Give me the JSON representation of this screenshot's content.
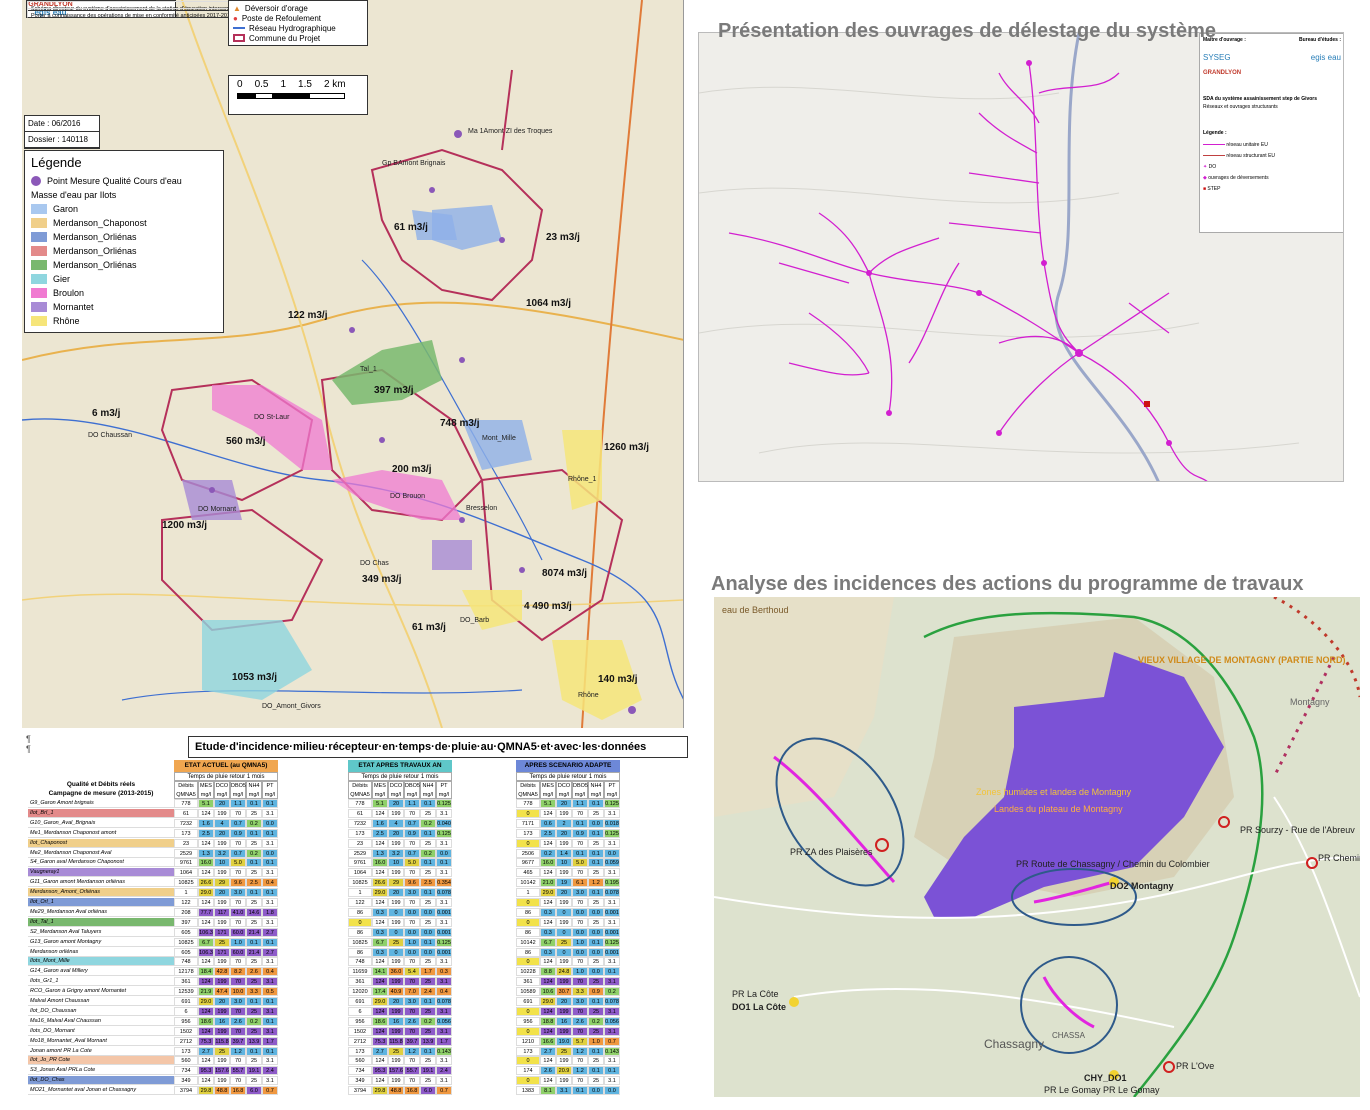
{
  "left_map": {
    "title_box": {
      "schema": "Schéma directeur du système d'assainissement de la station d'épuration intercommunale",
      "logo_grandlyon": "GRANDLYON",
      "porter": "Porter à connaissance des opérations de mise en conformité anticipées 2017-2019",
      "logo_egis": "egis eau"
    },
    "top_legend": [
      "Déversoir d'orage",
      "Poste de Refoulement",
      "Réseau Hydrographique",
      "Commune du Projet"
    ],
    "scale_labels": [
      "0",
      "0.5",
      "1",
      "1.5",
      "2 km"
    ],
    "date": "Date : 06/2016",
    "dossier": "Dossier : 140118",
    "legend": {
      "title": "Légende",
      "point_label": "Point Mesure Qualité Cours d'eau",
      "subtitle": "Masse d'eau par Ilots",
      "items": [
        {
          "label": "Garon",
          "color": "#a9c8ef"
        },
        {
          "label": "Merdanson_Chaponost",
          "color": "#f0cf8a"
        },
        {
          "label": "Merdanson_Orliénas",
          "color": "#7f9bd6"
        },
        {
          "label": "Merdanson_Orliénas",
          "color": "#e38a8a"
        },
        {
          "label": "Merdanson_Orliénas",
          "color": "#79b86e"
        },
        {
          "label": "Gier",
          "color": "#8fd6df"
        },
        {
          "label": "Broulon",
          "color": "#f07ad1"
        },
        {
          "label": "Mornantet",
          "color": "#a88bd6"
        },
        {
          "label": "Rhône",
          "color": "#f6e57a"
        }
      ]
    },
    "flows": [
      "61 m3/j",
      "23 m3/j",
      "1064 m3/j",
      "122 m3/j",
      "397 m3/j",
      "6 m3/j",
      "560 m3/j",
      "748 m3/j",
      "1260 m3/j",
      "200 m3/j",
      "1200 m3/j",
      "349 m3/j",
      "8074 m3/j",
      "4 490 m3/j",
      "61 m3/j",
      "1053 m3/j",
      "140 m3/j"
    ],
    "places": [
      "DO St-Laur",
      "DO Chaussan",
      "DO Mornant",
      "DO Brouon",
      "DO Chas",
      "Mont_Mille",
      "Rhône_1",
      "Tal_1",
      "DO_Barb",
      "DO_Amont_Givors",
      "Rhône",
      "Ma 1Amont ZI des Troques",
      "Bresselon",
      "Gp BAmont Brignais"
    ]
  },
  "table": {
    "title": "Etude·d'incidence·milieu·récepteur·en·temps·de·pluie·au·QMNA5·et·avec·les·données",
    "groups": [
      {
        "label": "ETAT ACTUEL (au QMNA5)",
        "color": "#f0a650"
      },
      {
        "label": "ETAT APRES TRAVAUX AN BOPES",
        "color": "#5fc7c9"
      },
      {
        "label": "APRES SCENARIO ADAPTE BASE EFR",
        "color": "#6d88d8"
      }
    ],
    "subheads": [
      "Temps de pluie retour 1 mois",
      "Temps de pluie retour 1 mois",
      "Temps de pluie retour 1 mois"
    ],
    "left_header": [
      "Qualité et Débits réels",
      "Campagne de mesure (2013-2015)"
    ],
    "cols": [
      "Débits QMNA5 m³/j",
      "MES mg/l",
      "DCO mg/l",
      "DBO5 mg/l",
      "NH4 mg/l",
      "PT mg/l"
    ],
    "rows": [
      {
        "label": "G9_Garon Amont brignais",
        "color": "#ffffff",
        "a": [
          "778",
          "5.1",
          "20",
          "1.1",
          "0.1",
          "0.1"
        ],
        "b": [
          "778",
          "5.1",
          "20",
          "1.1",
          "0.1",
          "0.125"
        ],
        "c": [
          "778",
          "5.1",
          "20",
          "1.1",
          "0.1",
          "0.125"
        ]
      },
      {
        "label": "Ilot_BrI_1",
        "color": "#e38a8a",
        "a": [
          "61",
          "124",
          "199",
          "70",
          "25",
          "3.1"
        ],
        "b": [
          "61",
          "124",
          "199",
          "70",
          "25",
          "3.1"
        ],
        "c": [
          "0",
          "124",
          "199",
          "70",
          "25",
          "3.1"
        ]
      },
      {
        "label": "G10_Garon_Aval_Brignais",
        "color": "#ffffff",
        "a": [
          "7232",
          "1.6",
          "4",
          "0.7",
          "0.2",
          "0.0"
        ],
        "b": [
          "7232",
          "1.6",
          "4",
          "0.7",
          "0.2",
          "0.040"
        ],
        "c": [
          "7171",
          "0.6",
          "2",
          "0.1",
          "0.0",
          "0.018"
        ]
      },
      {
        "label": "Me1_Merdanson Chaponost amont",
        "color": "#ffffff",
        "a": [
          "173",
          "2.5",
          "20",
          "0.9",
          "0.1",
          "0.1"
        ],
        "b": [
          "173",
          "2.5",
          "20",
          "0.9",
          "0.1",
          "0.125"
        ],
        "c": [
          "173",
          "2.5",
          "20",
          "0.9",
          "0.1",
          "0.125"
        ]
      },
      {
        "label": "Ilot_Chaponost",
        "color": "#f0cf8a",
        "a": [
          "23",
          "124",
          "199",
          "70",
          "25",
          "3.1"
        ],
        "b": [
          "23",
          "124",
          "199",
          "70",
          "25",
          "3.1"
        ],
        "c": [
          "0",
          "124",
          "199",
          "70",
          "25",
          "3.1"
        ]
      },
      {
        "label": "Me2_Merdanson Chaponost Aval",
        "color": "#ffffff",
        "a": [
          "2529",
          "1.3",
          "3.2",
          "0.7",
          "0.2",
          "0.0"
        ],
        "b": [
          "2529",
          "1.3",
          "3.2",
          "0.7",
          "0.2",
          "0.0"
        ],
        "c": [
          "2506",
          "0.2",
          "1.4",
          "0.1",
          "0.1",
          "0.0"
        ]
      },
      {
        "label": "S4_Garon aval Merdanson Chaponost",
        "color": "#ffffff",
        "a": [
          "9761",
          "16.0",
          "10",
          "5.0",
          "0.1",
          "0.1"
        ],
        "b": [
          "9761",
          "16.0",
          "10",
          "5.0",
          "0.1",
          "0.1"
        ],
        "c": [
          "9677",
          "16.0",
          "10",
          "5.0",
          "0.1",
          "0.059"
        ]
      },
      {
        "label": "Vaugneray1",
        "color": "#a88bd6",
        "a": [
          "1064",
          "124",
          "199",
          "70",
          "25",
          "3.1"
        ],
        "b": [
          "1064",
          "124",
          "199",
          "70",
          "25",
          "3.1"
        ],
        "c": [
          "465",
          "124",
          "199",
          "70",
          "25",
          "3.1"
        ]
      },
      {
        "label": "G11_Garon amont Merdanson orliénas",
        "color": "#ffffff",
        "a": [
          "10825",
          "26.6",
          "29",
          "9.6",
          "2.5",
          "0.4"
        ],
        "b": [
          "10825",
          "26.6",
          "29",
          "9.6",
          "2.5",
          "0.354"
        ],
        "c": [
          "10142",
          "21.0",
          "19",
          "6.1",
          "1.2",
          "0.195"
        ]
      },
      {
        "label": "Merdanson_Amont_Orliénas",
        "color": "#f0cf8a",
        "a": [
          "1",
          "29.0",
          "20",
          "3.0",
          "0.1",
          "0.1"
        ],
        "b": [
          "1",
          "29.0",
          "20",
          "3.0",
          "0.1",
          "0.078"
        ],
        "c": [
          "1",
          "29.0",
          "20",
          "3.0",
          "0.1",
          "0.078"
        ]
      },
      {
        "label": "Ilot_Orl_1",
        "color": "#7f9bd6",
        "a": [
          "122",
          "124",
          "199",
          "70",
          "25",
          "3.1"
        ],
        "b": [
          "122",
          "124",
          "199",
          "70",
          "25",
          "3.1"
        ],
        "c": [
          "0",
          "124",
          "199",
          "70",
          "25",
          "3.1"
        ]
      },
      {
        "label": "Me29_Merdanson Aval orliénas",
        "color": "#ffffff",
        "a": [
          "208",
          "77.7",
          "117",
          "41.0",
          "14.6",
          "1.8"
        ],
        "b": [
          "86",
          "0.3",
          "0",
          "0.0",
          "0.0",
          "0.001"
        ],
        "c": [
          "86",
          "0.3",
          "0",
          "0.0",
          "0.0",
          "0.001"
        ]
      },
      {
        "label": "Ilot_Tal_1",
        "color": "#79b86e",
        "a": [
          "397",
          "124",
          "199",
          "70",
          "25",
          "3.1"
        ],
        "b": [
          "0",
          "124",
          "199",
          "70",
          "25",
          "3.1"
        ],
        "c": [
          "0",
          "124",
          "199",
          "70",
          "25",
          "3.1"
        ]
      },
      {
        "label": "S2_Merdanson Aval Taluyers",
        "color": "#ffffff",
        "a": [
          "605",
          "106.3",
          "171",
          "60.0",
          "21.4",
          "2.7"
        ],
        "b": [
          "86",
          "0.3",
          "0",
          "0.0",
          "0.0",
          "0.001"
        ],
        "c": [
          "86",
          "0.3",
          "0",
          "0.0",
          "0.0",
          "0.001"
        ]
      },
      {
        "label": "G13_Garon amont Montagny",
        "color": "#ffffff",
        "a": [
          "10825",
          "6.7",
          "25",
          "1.0",
          "0.1",
          "0.1"
        ],
        "b": [
          "10825",
          "6.7",
          "25",
          "1.0",
          "0.1",
          "0.125"
        ],
        "c": [
          "10142",
          "6.7",
          "25",
          "1.0",
          "0.1",
          "0.125"
        ]
      },
      {
        "label": "Merdanson orliénas",
        "color": "#ffffff",
        "a": [
          "605",
          "106.3",
          "171",
          "60.0",
          "21.4",
          "2.7"
        ],
        "b": [
          "86",
          "0.3",
          "0",
          "0.0",
          "0.0",
          "0.001"
        ],
        "c": [
          "86",
          "0.3",
          "0",
          "0.0",
          "0.0",
          "0.001"
        ]
      },
      {
        "label": "Ilots_Mont_Mille",
        "color": "#8fd6df",
        "a": [
          "748",
          "124",
          "199",
          "70",
          "25",
          "3.1"
        ],
        "b": [
          "748",
          "124",
          "199",
          "70",
          "25",
          "3.1"
        ],
        "c": [
          "0",
          "124",
          "199",
          "70",
          "25",
          "3.1"
        ]
      },
      {
        "label": "G14_Garon aval Millery",
        "color": "#ffffff",
        "a": [
          "12178",
          "18.4",
          "42.8",
          "8.2",
          "2.6",
          "0.4"
        ],
        "b": [
          "11659",
          "14.1",
          "36.0",
          "5.4",
          "1.7",
          "0.3"
        ],
        "c": [
          "10228",
          "8.8",
          "24.8",
          "1.0",
          "0.0",
          "0.1"
        ]
      },
      {
        "label": "Ilots_Gr1_1",
        "color": "#ffffff",
        "a": [
          "361",
          "124",
          "199",
          "70",
          "25",
          "3.1"
        ],
        "b": [
          "361",
          "124",
          "199",
          "70",
          "25",
          "3.1"
        ],
        "c": [
          "361",
          "124",
          "199",
          "70",
          "25",
          "3.1"
        ]
      },
      {
        "label": "RCO_Garon à Grigny amont Mornantet",
        "color": "#ffffff",
        "a": [
          "12539",
          "21.9",
          "47.4",
          "10.0",
          "3.3",
          "0.5"
        ],
        "b": [
          "12020",
          "17.4",
          "40.9",
          "7.0",
          "2.4",
          "0.4"
        ],
        "c": [
          "10589",
          "10.6",
          "30.7",
          "3.3",
          "0.9",
          "0.2"
        ]
      },
      {
        "label": "Malval Amont Chaussan",
        "color": "#ffffff",
        "a": [
          "691",
          "29.0",
          "20",
          "3.0",
          "0.1",
          "0.1"
        ],
        "b": [
          "691",
          "29.0",
          "20",
          "3.0",
          "0.1",
          "0.078"
        ],
        "c": [
          "691",
          "29.0",
          "20",
          "3.0",
          "0.1",
          "0.078"
        ]
      },
      {
        "label": "Ilot_DO_Chaussan",
        "color": "#ffffff",
        "a": [
          "6",
          "124",
          "199",
          "70",
          "25",
          "3.1"
        ],
        "b": [
          "6",
          "124",
          "199",
          "70",
          "25",
          "3.1"
        ],
        "c": [
          "0",
          "124",
          "199",
          "70",
          "25",
          "3.1"
        ]
      },
      {
        "label": "Ma16_Malval Aval Chaussan",
        "color": "#ffffff",
        "a": [
          "956",
          "18.6",
          "16",
          "2.6",
          "0.2",
          "0.1"
        ],
        "b": [
          "956",
          "18.6",
          "16",
          "2.6",
          "0.2",
          "0.056"
        ],
        "c": [
          "956",
          "18.8",
          "16",
          "2.6",
          "0.2",
          "0.056"
        ]
      },
      {
        "label": "Ilots_DO_Mornant",
        "color": "#ffffff",
        "a": [
          "1502",
          "124",
          "199",
          "70",
          "25",
          "3.1"
        ],
        "b": [
          "1502",
          "124",
          "199",
          "70",
          "25",
          "3.1"
        ],
        "c": [
          "0",
          "124",
          "199",
          "70",
          "25",
          "3.1"
        ]
      },
      {
        "label": "Mo18_Mornantet_Aval Mornant",
        "color": "#ffffff",
        "a": [
          "2712",
          "75.3",
          "115.8",
          "39.7",
          "13.9",
          "1.7"
        ],
        "b": [
          "2712",
          "75.3",
          "115.8",
          "39.7",
          "13.9",
          "1.7"
        ],
        "c": [
          "1210",
          "16.6",
          "19.0",
          "5.7",
          "1.0",
          "0.7"
        ]
      },
      {
        "label": "Jonan amont PR La Cote",
        "color": "#ffffff",
        "a": [
          "173",
          "2.7",
          "25",
          "1.2",
          "0.1",
          "0.1"
        ],
        "b": [
          "173",
          "2.7",
          "25",
          "1.2",
          "0.1",
          "0.143"
        ],
        "c": [
          "173",
          "2.7",
          "25",
          "1.2",
          "0.1",
          "0.143"
        ]
      },
      {
        "label": "Ilot_Jo_PR Cote",
        "color": "#f4c6a8",
        "a": [
          "560",
          "124",
          "199",
          "70",
          "25",
          "3.1"
        ],
        "b": [
          "560",
          "124",
          "199",
          "70",
          "25",
          "3.1"
        ],
        "c": [
          "0",
          "124",
          "199",
          "70",
          "25",
          "3.1"
        ]
      },
      {
        "label": "S3_Jonan Aval PRLa Cote",
        "color": "#ffffff",
        "a": [
          "734",
          "95.3",
          "157.6",
          "55.7",
          "19.1",
          "2.4"
        ],
        "b": [
          "734",
          "95.3",
          "157.6",
          "55.7",
          "19.1",
          "2.4"
        ],
        "c": [
          "174",
          "2.6",
          "20.9",
          "1.2",
          "0.1",
          "0.1"
        ]
      },
      {
        "label": "Ilot_DO_Chas",
        "color": "#7f9bd6",
        "a": [
          "349",
          "124",
          "199",
          "70",
          "25",
          "3.1"
        ],
        "b": [
          "349",
          "124",
          "199",
          "70",
          "25",
          "3.1"
        ],
        "c": [
          "0",
          "124",
          "199",
          "70",
          "25",
          "3.1"
        ]
      },
      {
        "label": "MO21_Mornantet aval Jonan et Chassagny",
        "color": "#ffffff",
        "a": [
          "3794",
          "29.8",
          "48.8",
          "16.8",
          "6.0",
          "0.7"
        ],
        "b": [
          "3794",
          "29.8",
          "48.8",
          "16.8",
          "6.0",
          "0.7"
        ],
        "c": [
          "1383",
          "8.1",
          "3.1",
          "0.1",
          "0.0",
          "0.0"
        ]
      }
    ]
  },
  "right_top": {
    "title": "Présentation des ouvrages de délestage du système",
    "cartouche": {
      "maitre": "Maître d'ouvrage :",
      "bureau": "Bureau d'études :",
      "sysego": "SYSEG",
      "egis": "egis eau",
      "grandlyon": "GRANDLYON",
      "sda": "SDA du système assainissement step de Givors",
      "reseaux": "Réseaux et ouvrages structurants",
      "legende": "Légende :",
      "items": [
        "réseau unitaire EU",
        "réseau structurant EU",
        "DO",
        "ouvrages de déversements",
        "STEP"
      ]
    }
  },
  "right_bottom": {
    "title": "Analyse des incidences des actions du programme de travaux",
    "labels": {
      "berthoud": "eau de Berthoud",
      "vieux_village": "VIEUX VILLAGE DE MONTAGNY (PARTIE NORD)",
      "montagny": "Montagny",
      "zones_humides": "Zones humides et landes de Montagny",
      "landes": "Landes du plateau de Montagny",
      "pr_za": "PR ZA des Plaisères",
      "pr_route": "PR Route de Chassagny / Chemin du Colombier",
      "do2": "DO2 Montagny",
      "pr_sourzy": "PR Sourzy - Rue de l'Abreuv",
      "pr_chemin": "PR Chemin",
      "pr_la_cote": "PR La Côte",
      "do1": "DO1 La Côte",
      "chassagny": "Chassagny",
      "chassag_small": "CHASSA",
      "chy_do1": "CHY_DO1",
      "pr_gomay": "PR Le Gomay PR Le Gomay",
      "pr_love": "PR L'Ove"
    }
  }
}
